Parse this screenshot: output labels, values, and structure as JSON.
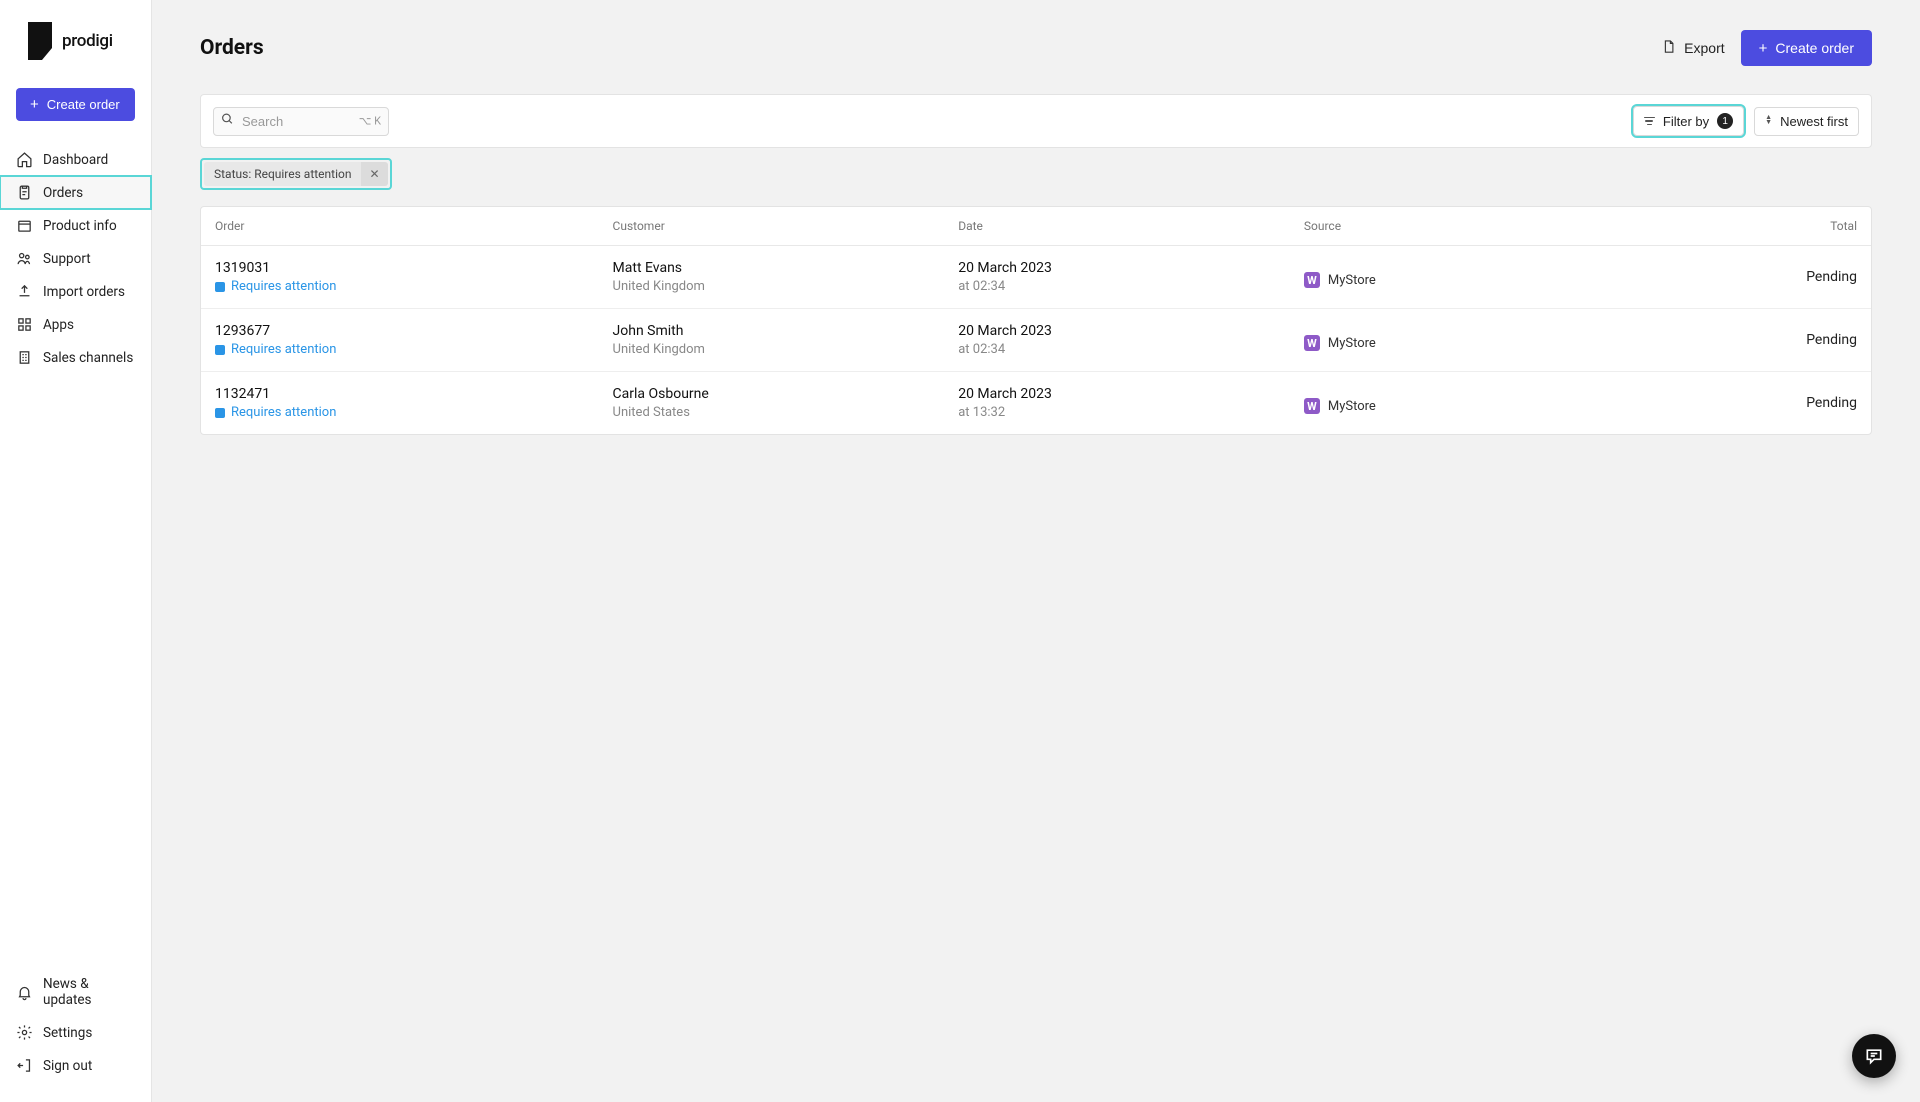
{
  "brand": {
    "name": "prodigi"
  },
  "sidebar": {
    "create_label": "Create order",
    "nav": [
      {
        "label": "Dashboard",
        "icon": "home"
      },
      {
        "label": "Orders",
        "icon": "clipboard",
        "active": true,
        "highlighted": true
      },
      {
        "label": "Product info",
        "icon": "box"
      },
      {
        "label": "Support",
        "icon": "people"
      },
      {
        "label": "Import orders",
        "icon": "upload"
      },
      {
        "label": "Apps",
        "icon": "grid"
      },
      {
        "label": "Sales channels",
        "icon": "building"
      }
    ],
    "footer_nav": [
      {
        "label": "News & updates",
        "icon": "bell"
      },
      {
        "label": "Settings",
        "icon": "gear"
      },
      {
        "label": "Sign out",
        "icon": "signout"
      }
    ]
  },
  "page": {
    "title": "Orders",
    "export_label": "Export",
    "create_label": "Create order"
  },
  "toolbar": {
    "search_placeholder": "Search",
    "search_kbd": "⌥ K",
    "filter_label": "Filter by",
    "filter_count": "1",
    "sort_label": "Newest first"
  },
  "active_filter": {
    "label": "Status: Requires attention"
  },
  "table": {
    "columns": [
      "Order",
      "Customer",
      "Date",
      "Source",
      "Total"
    ],
    "rows": [
      {
        "order_id": "1319031",
        "status": "Requires attention",
        "customer_name": "Matt Evans",
        "customer_country": "United Kingdom",
        "date": "20 March 2023",
        "time": "at 02:34",
        "source_badge": "W",
        "source_name": "MyStore",
        "total": "Pending"
      },
      {
        "order_id": "1293677",
        "status": "Requires attention",
        "customer_name": "John Smith",
        "customer_country": "United Kingdom",
        "date": "20 March 2023",
        "time": "at 02:34",
        "source_badge": "W",
        "source_name": "MyStore",
        "total": "Pending"
      },
      {
        "order_id": "1132471",
        "status": "Requires attention",
        "customer_name": "Carla Osbourne",
        "customer_country": "United States",
        "date": "20 March 2023",
        "time": "at 13:32",
        "source_badge": "W",
        "source_name": "MyStore",
        "total": "Pending"
      }
    ]
  }
}
